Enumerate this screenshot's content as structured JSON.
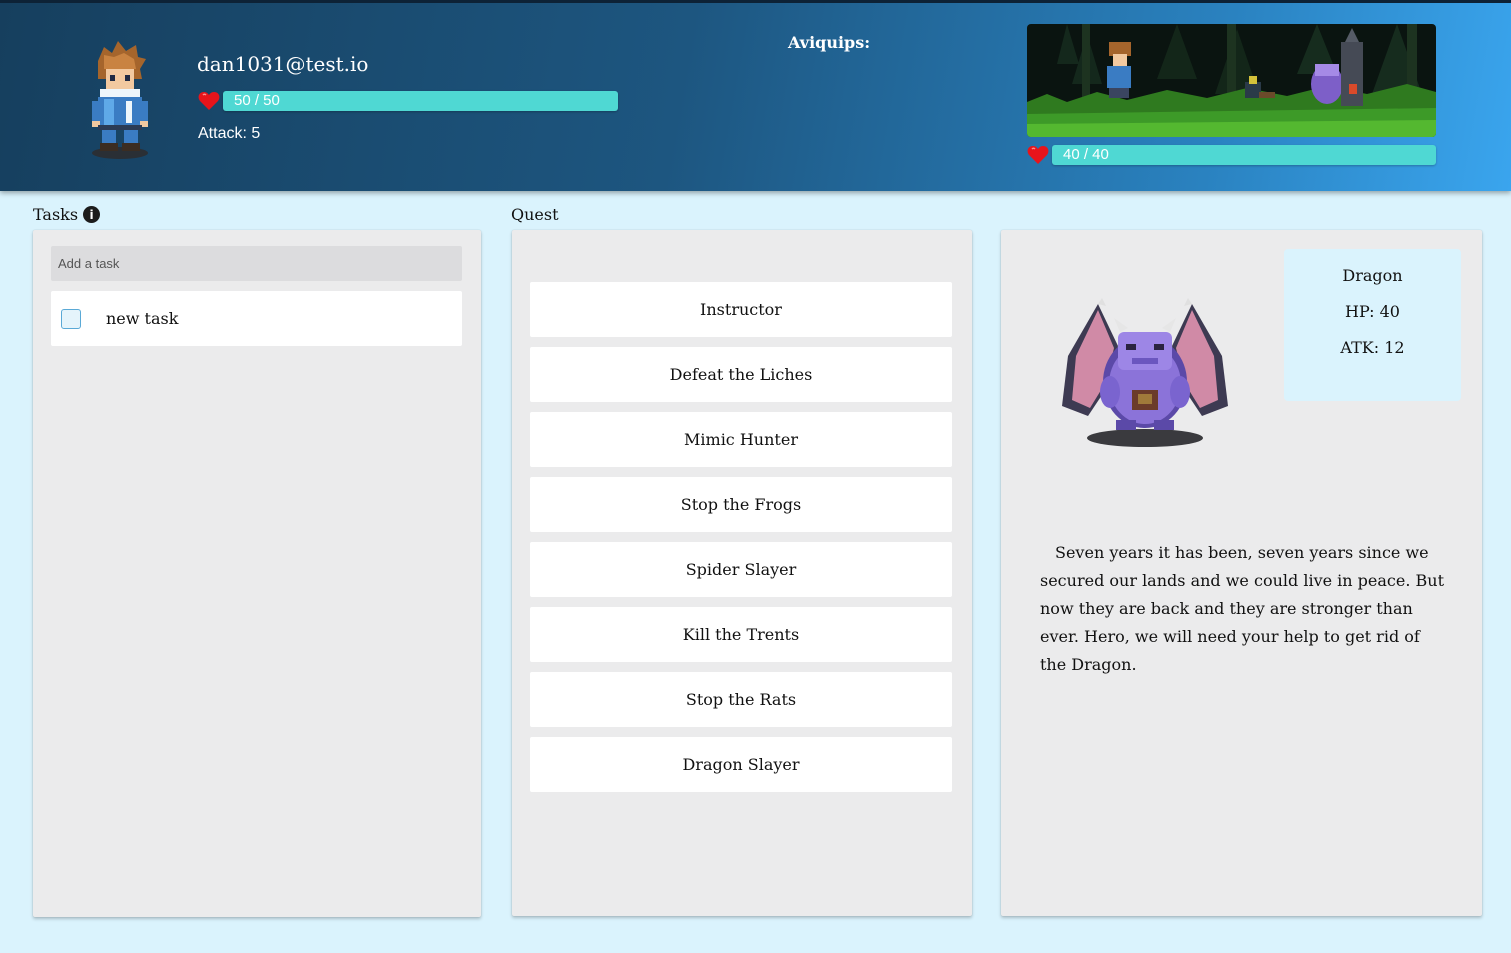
{
  "player": {
    "username": "dan1031@test.io",
    "hp_text": "50 / 50",
    "hp_fraction": 1.0,
    "attack_text": "Attack: 5"
  },
  "header": {
    "aviquips_label": "Aviquips:"
  },
  "enemy": {
    "hp_text": "40 / 40",
    "hp_fraction": 1.0
  },
  "tasks": {
    "label": "Tasks",
    "info_glyph": "i",
    "input_placeholder": "Add a task",
    "items": [
      {
        "label": "new task",
        "checked": false
      }
    ]
  },
  "quest": {
    "label": "Quest",
    "items": [
      "Instructor",
      "Defeat the Liches",
      "Mimic Hunter",
      "Stop the Frogs",
      "Spider Slayer",
      "Kill the Trents",
      "Stop the Rats",
      "Dragon Slayer"
    ]
  },
  "detail": {
    "name": "Dragon",
    "hp": "HP: 40",
    "atk": "ATK: 12",
    "description": "Seven years it has been, seven years since we secured our lands and we could live in peace. But now they are back and they are stronger than ever. Hero, we will need your help to get rid of the Dragon."
  },
  "colors": {
    "hp_bar": "#4fd8d3",
    "page_background": "#daf3fd",
    "panel_background": "#ebebec",
    "stats_card": "#daf3fd"
  },
  "icons": {
    "heart": "heart-icon",
    "info": "info-icon",
    "checkbox": "checkbox-icon"
  }
}
